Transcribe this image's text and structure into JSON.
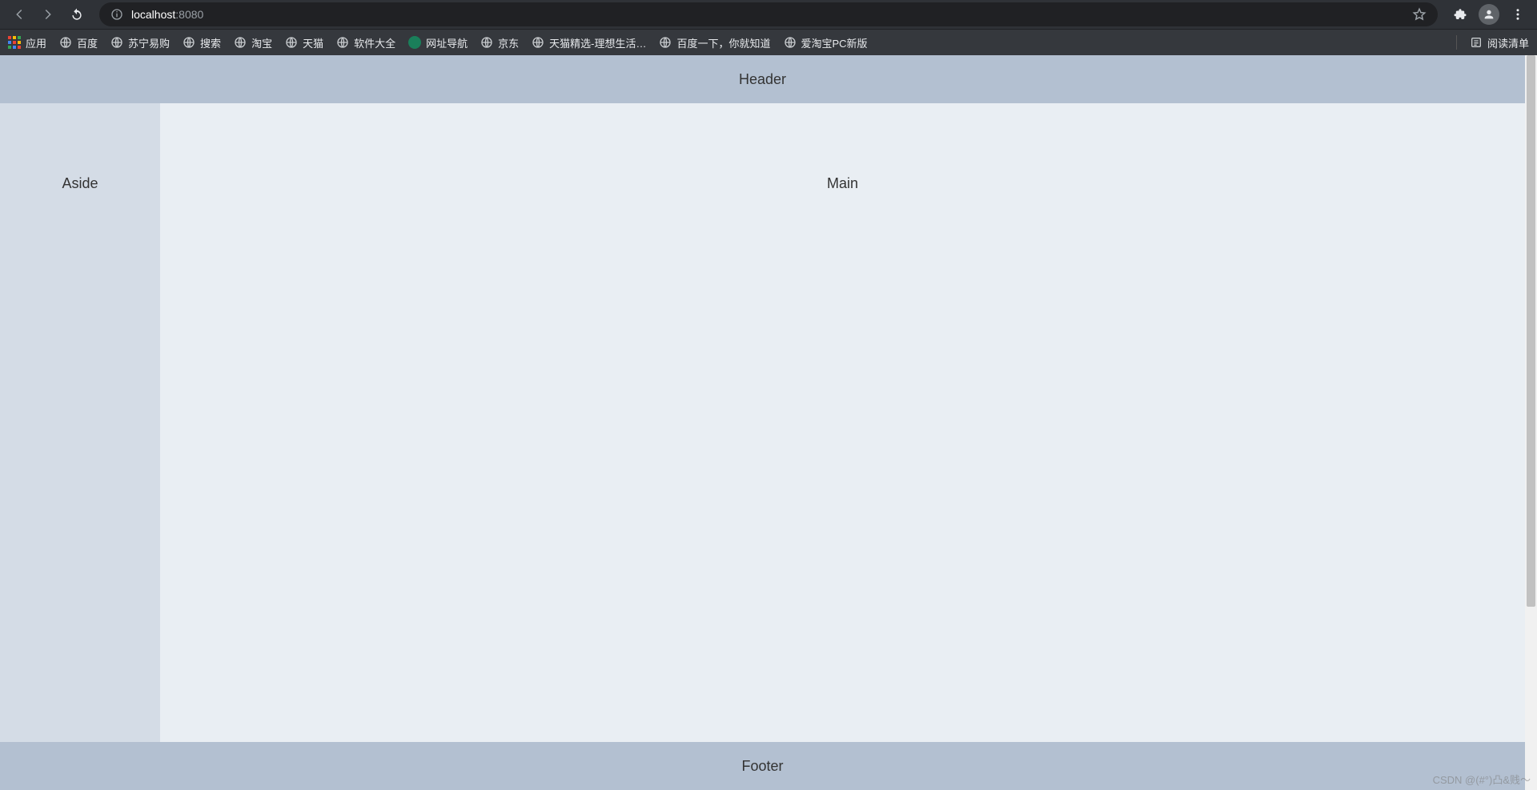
{
  "browser": {
    "url_host": "localhost",
    "url_port": ":8080",
    "bookmarks": [
      {
        "id": "apps",
        "label": "应用",
        "icon": "apps"
      },
      {
        "id": "baidu",
        "label": "百度",
        "icon": "globe"
      },
      {
        "id": "suning",
        "label": "苏宁易购",
        "icon": "globe"
      },
      {
        "id": "search",
        "label": "搜索",
        "icon": "globe"
      },
      {
        "id": "taobao",
        "label": "淘宝",
        "icon": "globe"
      },
      {
        "id": "tmall",
        "label": "天猫",
        "icon": "globe"
      },
      {
        "id": "softmall",
        "label": "软件大全",
        "icon": "globe"
      },
      {
        "id": "wzhdh",
        "label": "网址导航",
        "icon": "green"
      },
      {
        "id": "jd",
        "label": "京东",
        "icon": "globe"
      },
      {
        "id": "tmjx",
        "label": "天猫精选-理想生活…",
        "icon": "globe"
      },
      {
        "id": "baiduyx",
        "label": "百度一下，你就知道",
        "icon": "globe"
      },
      {
        "id": "aitaobao",
        "label": "爱淘宝PC新版",
        "icon": "globe"
      }
    ],
    "reading_list_label": "阅读清单"
  },
  "page": {
    "header": "Header",
    "aside": "Aside",
    "main": "Main",
    "footer": "Footer"
  },
  "watermark": "CSDN @(#°)凸&贱～"
}
